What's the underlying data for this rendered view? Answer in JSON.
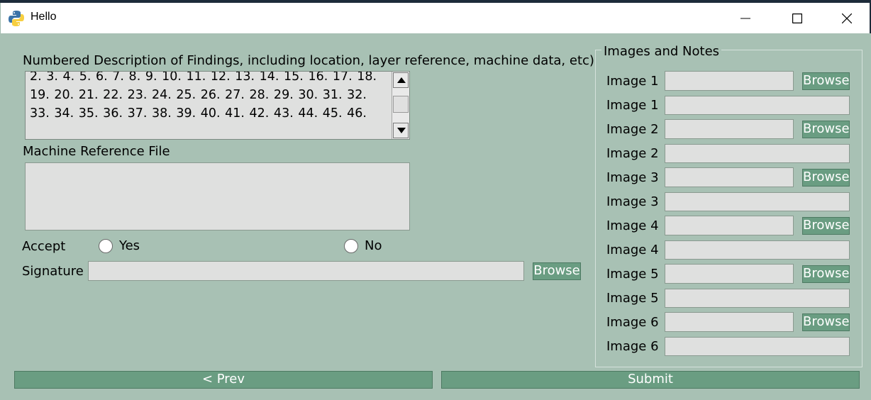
{
  "window": {
    "title": "Hello",
    "icon": "python-icon"
  },
  "findings": {
    "label": "Numbered Description of Findings, including location, layer reference, machine data, etc)",
    "text": "2. 3. 4. 5. 6. 7. 8. 9. 10. 11. 12. 13. 14. 15. 16. 17. 18. 19. 20. 21. 22. 23. 24. 25. 26. 27. 28. 29. 30. 31. 32. 33. 34. 35. 36. 37. 38. 39. 40. 41. 42. 43. 44. 45. 46."
  },
  "machine_reference": {
    "label": "Machine Reference File",
    "value": ""
  },
  "accept": {
    "label": "Accept",
    "yes": "Yes",
    "no": "No"
  },
  "signature": {
    "label": "Signature",
    "value": "",
    "browse": "Browse"
  },
  "images": {
    "title": "Images and Notes",
    "rows": [
      {
        "label": "Image 1",
        "browse": "Browse"
      },
      {
        "label": "Image 1"
      },
      {
        "label": "Image 2",
        "browse": "Browse"
      },
      {
        "label": "Image 2"
      },
      {
        "label": "Image 3",
        "browse": "Browse"
      },
      {
        "label": "Image 3"
      },
      {
        "label": "Image 4",
        "browse": "Browse"
      },
      {
        "label": "Image 4"
      },
      {
        "label": "Image 5",
        "browse": "Browse"
      },
      {
        "label": "Image 5"
      },
      {
        "label": "Image 6",
        "browse": "Browse"
      },
      {
        "label": "Image 6"
      }
    ]
  },
  "nav": {
    "prev": "< Prev",
    "submit": "Submit"
  },
  "colors": {
    "background": "#a8c1b4",
    "button": "#6a9d82",
    "field": "#dfe0df"
  }
}
